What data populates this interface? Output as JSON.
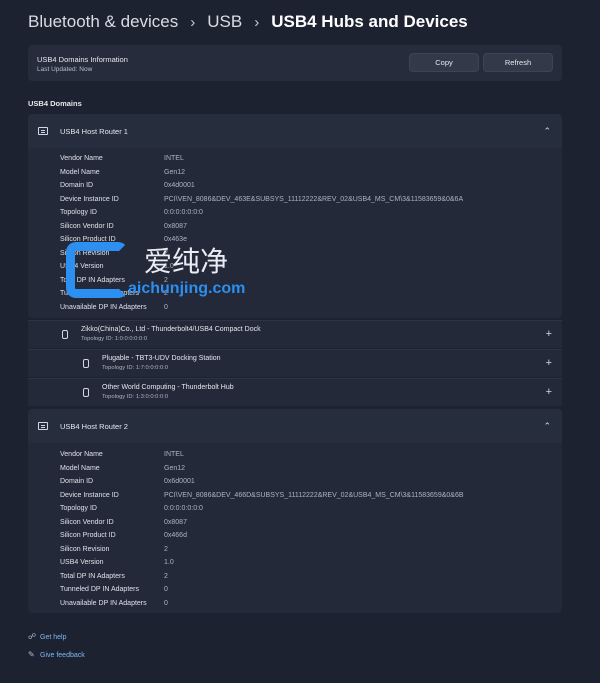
{
  "breadcrumb": {
    "items": [
      "Bluetooth & devices",
      "USB",
      "USB4 Hubs and Devices"
    ],
    "separator": "›"
  },
  "info_card": {
    "title": "USB4 Domains Information",
    "last_updated": "Last Updated:  Now",
    "copy_label": "Copy",
    "refresh_label": "Refresh"
  },
  "section_title": "USB4 Domains",
  "routers": [
    {
      "name": "USB4 Host Router 1",
      "props": [
        {
          "k": "Vendor Name",
          "v": "INTEL"
        },
        {
          "k": "Model Name",
          "v": "Gen12"
        },
        {
          "k": "Domain ID",
          "v": "0x4d0001"
        },
        {
          "k": "Device Instance ID",
          "v": "PCI\\VEN_8086&DEV_463E&SUBSYS_11112222&REV_02&USB4_MS_CM\\3&11583659&0&6A"
        },
        {
          "k": "Topology ID",
          "v": "0:0:0:0:0:0:0"
        },
        {
          "k": "Silicon Vendor ID",
          "v": "0x8087"
        },
        {
          "k": "Silicon Product ID",
          "v": "0x463e"
        },
        {
          "k": "Silicon Revision",
          "v": "2"
        },
        {
          "k": "USB4 Version",
          "v": "1.0"
        },
        {
          "k": "Total DP IN Adapters",
          "v": "2"
        },
        {
          "k": "Tunneled DP IN Adapters",
          "v": "2"
        },
        {
          "k": "Unavailable DP IN Adapters",
          "v": "0"
        }
      ],
      "devices": [
        {
          "name": "Zikko(China)Co., Ltd - Thunderbolt4/USB4 Compact Dock",
          "topology": "Topology ID:  1:0:0:0:0:0:0"
        },
        {
          "name": "Plugable - TBT3-UDV Docking Station",
          "topology": "Topology ID:  1:7:0:0:0:0:0"
        },
        {
          "name": "Other World Computing - Thunderbolt Hub",
          "topology": "Topology ID:  1:3:0:0:0:0:0"
        }
      ]
    },
    {
      "name": "USB4 Host Router 2",
      "props": [
        {
          "k": "Vendor Name",
          "v": "INTEL"
        },
        {
          "k": "Model Name",
          "v": "Gen12"
        },
        {
          "k": "Domain ID",
          "v": "0x6d0001"
        },
        {
          "k": "Device Instance ID",
          "v": "PCI\\VEN_8086&DEV_466D&SUBSYS_11112222&REV_02&USB4_MS_CM\\3&11583659&0&6B"
        },
        {
          "k": "Topology ID",
          "v": "0:0:0:0:0:0:0"
        },
        {
          "k": "Silicon Vendor ID",
          "v": "0x8087"
        },
        {
          "k": "Silicon Product ID",
          "v": "0x466d"
        },
        {
          "k": "Silicon Revision",
          "v": "2"
        },
        {
          "k": "USB4 Version",
          "v": "1.0"
        },
        {
          "k": "Total DP IN Adapters",
          "v": "2"
        },
        {
          "k": "Tunneled DP IN Adapters",
          "v": "0"
        },
        {
          "k": "Unavailable DP IN Adapters",
          "v": "0"
        }
      ]
    }
  ],
  "links": {
    "help": "Get help",
    "feedback": "Give feedback"
  },
  "watermark": {
    "text": "爱纯净",
    "url": "aichunjing.com"
  },
  "icons": {
    "router": "router-icon",
    "device": "usb-device-icon",
    "expand_open": "chevron-up-icon",
    "expand_closed": "plus-icon",
    "help": "help-icon",
    "feedback": "feedback-icon"
  },
  "colors": {
    "background": "#1d2231",
    "card": "#262c3b",
    "link": "#7fb7ee",
    "watermark_blue": "#2d8ff0"
  }
}
